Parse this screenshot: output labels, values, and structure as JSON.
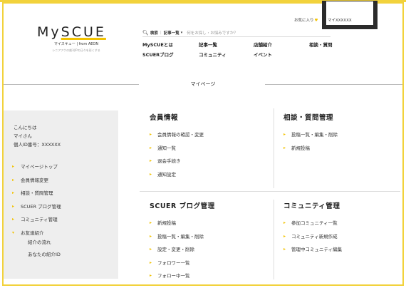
{
  "brand": {
    "logo_text_a": "My",
    "logo_text_b": "SCUE",
    "logo_sub": "マイスキュー | from AEON",
    "logo_tag": "シニアアクの創刊IPの日々を彩くする"
  },
  "header": {
    "favorites_label": "お気に入り",
    "mypage_label": "マイXXXXXX",
    "search": {
      "icon": "search-icon",
      "label": "検索",
      "category": "記事一覧",
      "placeholder": "何をお探し・お悩みですか？"
    },
    "nav": [
      "MySCUEとは",
      "記事一覧",
      "店舗紹介",
      "相談・質問",
      "SCUERブログ",
      "コミュニティ",
      "イベント"
    ]
  },
  "page_title": "マイページ",
  "sidebar": {
    "greeting": "こんにちは",
    "user_name": "マイさん",
    "user_id": "個人ID番号：XXXXXX",
    "items": [
      "マイページトップ",
      "会員情報変更",
      "相談・質問管理",
      "SCUER ブログ管理",
      "コミュニティ管理",
      "お友達紹介"
    ],
    "sub_items": [
      "紹介の流れ",
      "あなたの紹介ID"
    ]
  },
  "sections": {
    "member": {
      "title": "会員情報",
      "items": [
        "会員情報の確認・変更",
        "通知一覧",
        "退会手続き",
        "通知設定"
      ]
    },
    "qa": {
      "title": "相談・質問管理",
      "items": [
        "投稿一覧・編集・削除",
        "新規投稿"
      ]
    },
    "blog": {
      "title": "SCUER ブログ管理",
      "items": [
        "新規投稿",
        "投稿一覧・編集・削除",
        "設定・変更・削除",
        "フォロワー一覧",
        "フォロー中一覧"
      ]
    },
    "community": {
      "title": "コミュニティ管理",
      "items": [
        "参加コミュニティ一覧",
        "コミュニティ新規作成",
        "管理中コミュニティ編集"
      ]
    }
  },
  "colors": {
    "accent": "#f2c200",
    "frame": "#f2d23c",
    "sidebar_bg": "#eeeeee",
    "highlight_box": "#2b2b2b"
  }
}
